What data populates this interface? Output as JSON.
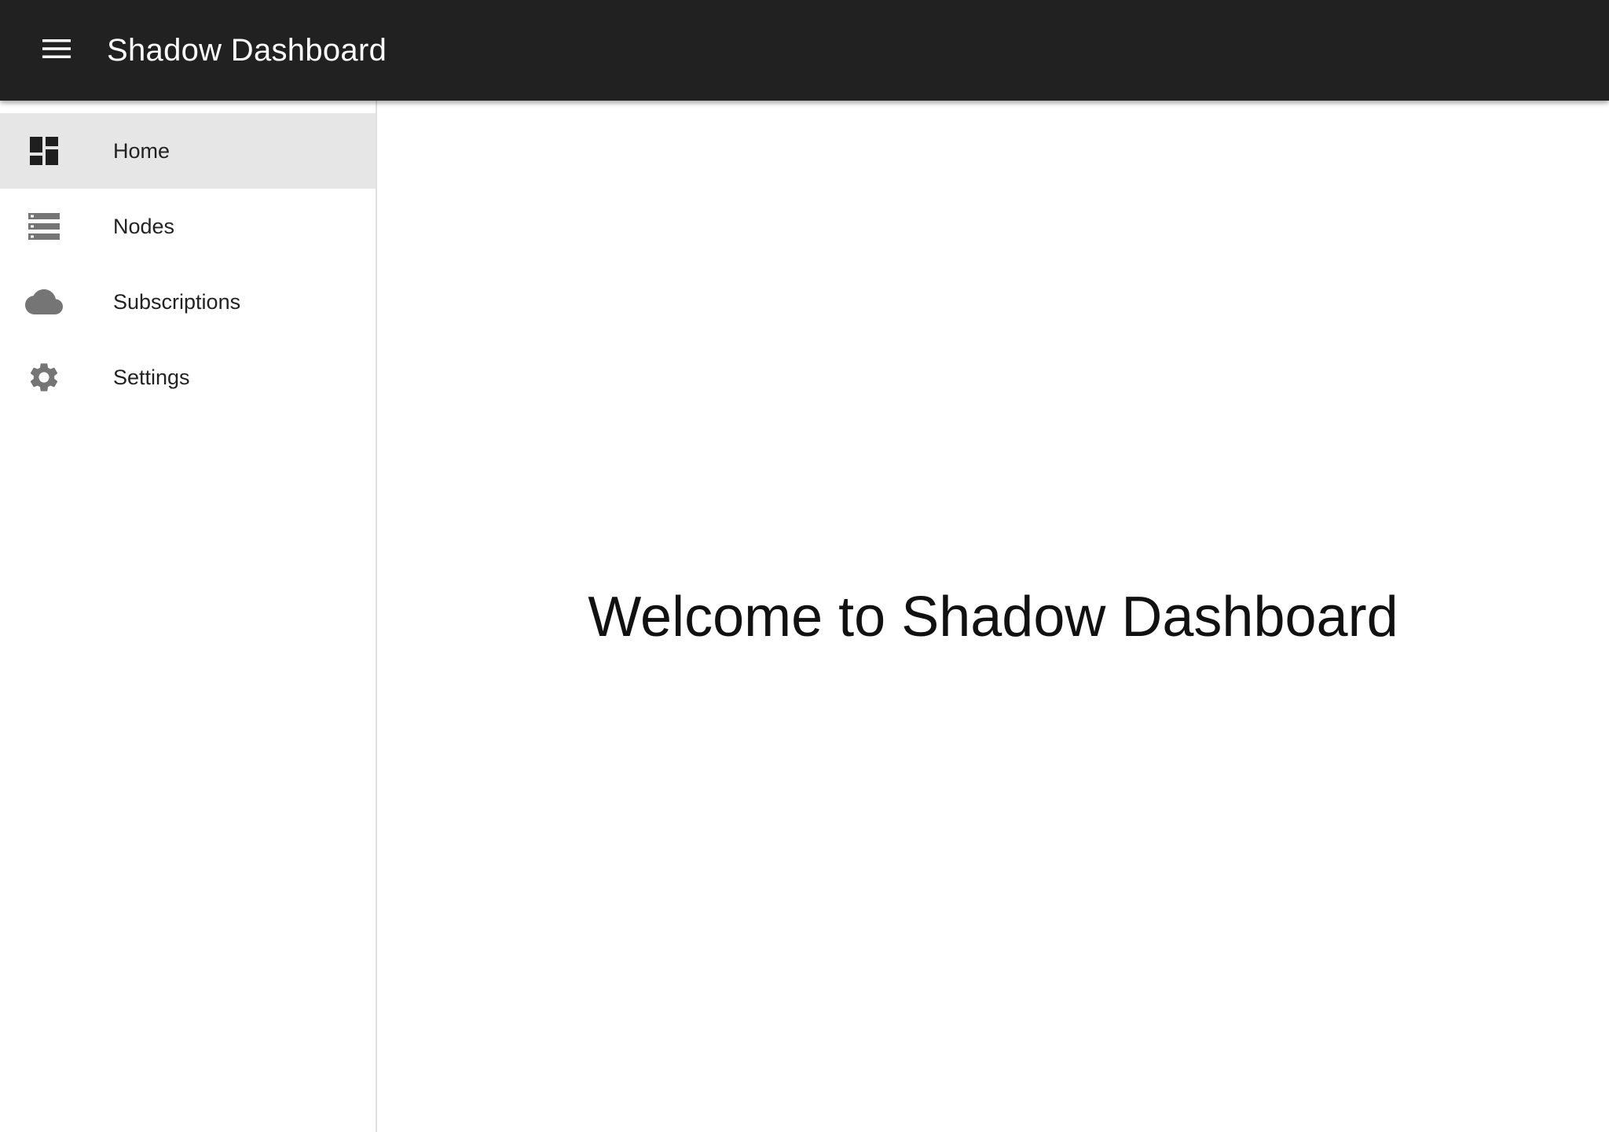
{
  "app_bar": {
    "title": "Shadow Dashboard",
    "background": "#212121",
    "menu_icon": "hamburger-menu-icon"
  },
  "sidebar": {
    "items": [
      {
        "label": "Home",
        "icon": "dashboard-icon",
        "active": true
      },
      {
        "label": "Nodes",
        "icon": "storage-list-icon",
        "active": false
      },
      {
        "label": "Subscriptions",
        "icon": "cloud-icon",
        "active": false
      },
      {
        "label": "Settings",
        "icon": "gear-icon",
        "active": false
      }
    ],
    "active_background": "#e6e6e6"
  },
  "main": {
    "welcome_text": "Welcome to Shadow Dashboard"
  }
}
